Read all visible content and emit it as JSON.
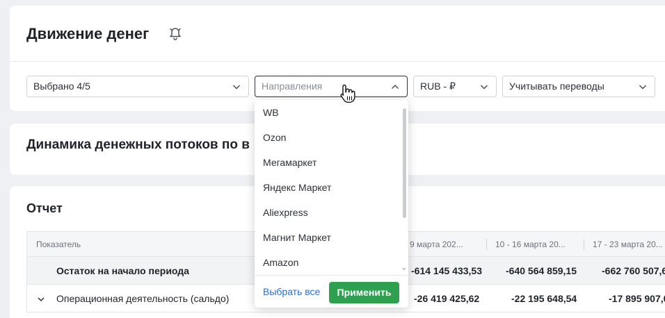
{
  "header": {
    "title": "Движение денег",
    "bell_icon": "bell-off-icon"
  },
  "filters": {
    "chosen": {
      "label": "Выбрано 4/5"
    },
    "directions": {
      "label": "Направления",
      "open": true
    },
    "currency": {
      "label": "RUB - ₽"
    },
    "transfers": {
      "label": "Учитывать переводы"
    }
  },
  "dynamics": {
    "title": "Динамика денежных потоков по в"
  },
  "report": {
    "title": "Отчет",
    "columns": [
      "Показатель",
      "9 марта 202...",
      "10 - 16 марта 20...",
      "17 - 23 марта 20..."
    ],
    "rows": [
      {
        "name": "Остаток на начало периода",
        "values": [
          "-614 145 433,53",
          "-640 564 859,15",
          "-662 760 507,6"
        ]
      },
      {
        "name": "Операционная деятельность (сальдо)",
        "values": [
          "-26 419 425,62",
          "-22 195 648,54",
          "-17 895 907,0"
        ]
      }
    ]
  },
  "dropdown": {
    "items": [
      "WB",
      "Ozon",
      "Мегамаркет",
      "Яндекс Маркет",
      "Aliexpress",
      "Магнит Маркет",
      "Amazon"
    ],
    "select_all_label": "Выбрать все",
    "apply_label": "Применить"
  },
  "colors": {
    "accent_green": "#2ea04f",
    "link_blue": "#2a6fd6"
  }
}
